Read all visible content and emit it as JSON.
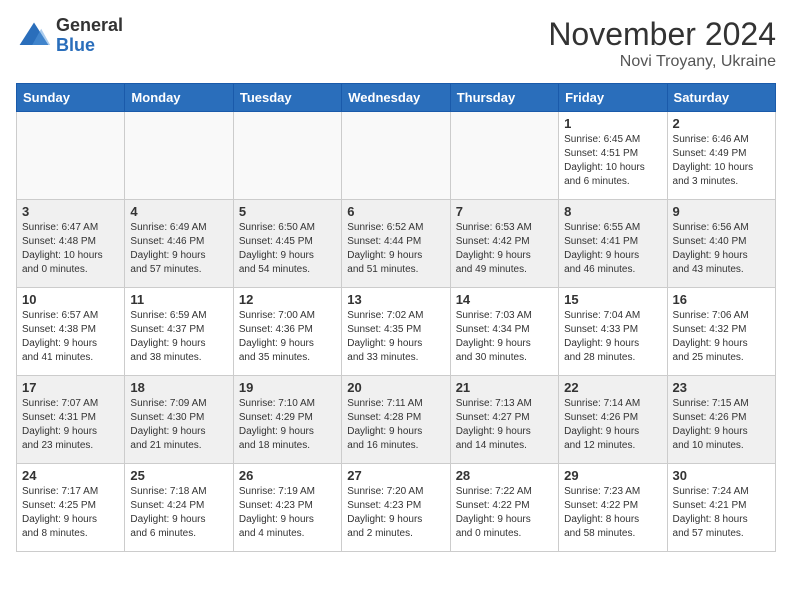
{
  "header": {
    "logo_general": "General",
    "logo_blue": "Blue",
    "month_title": "November 2024",
    "location": "Novi Troyany, Ukraine"
  },
  "weekdays": [
    "Sunday",
    "Monday",
    "Tuesday",
    "Wednesday",
    "Thursday",
    "Friday",
    "Saturday"
  ],
  "weeks": [
    [
      {
        "day": "",
        "info": "",
        "empty": true
      },
      {
        "day": "",
        "info": "",
        "empty": true
      },
      {
        "day": "",
        "info": "",
        "empty": true
      },
      {
        "day": "",
        "info": "",
        "empty": true
      },
      {
        "day": "",
        "info": "",
        "empty": true
      },
      {
        "day": "1",
        "info": "Sunrise: 6:45 AM\nSunset: 4:51 PM\nDaylight: 10 hours\nand 6 minutes."
      },
      {
        "day": "2",
        "info": "Sunrise: 6:46 AM\nSunset: 4:49 PM\nDaylight: 10 hours\nand 3 minutes."
      }
    ],
    [
      {
        "day": "3",
        "info": "Sunrise: 6:47 AM\nSunset: 4:48 PM\nDaylight: 10 hours\nand 0 minutes."
      },
      {
        "day": "4",
        "info": "Sunrise: 6:49 AM\nSunset: 4:46 PM\nDaylight: 9 hours\nand 57 minutes."
      },
      {
        "day": "5",
        "info": "Sunrise: 6:50 AM\nSunset: 4:45 PM\nDaylight: 9 hours\nand 54 minutes."
      },
      {
        "day": "6",
        "info": "Sunrise: 6:52 AM\nSunset: 4:44 PM\nDaylight: 9 hours\nand 51 minutes."
      },
      {
        "day": "7",
        "info": "Sunrise: 6:53 AM\nSunset: 4:42 PM\nDaylight: 9 hours\nand 49 minutes."
      },
      {
        "day": "8",
        "info": "Sunrise: 6:55 AM\nSunset: 4:41 PM\nDaylight: 9 hours\nand 46 minutes."
      },
      {
        "day": "9",
        "info": "Sunrise: 6:56 AM\nSunset: 4:40 PM\nDaylight: 9 hours\nand 43 minutes."
      }
    ],
    [
      {
        "day": "10",
        "info": "Sunrise: 6:57 AM\nSunset: 4:38 PM\nDaylight: 9 hours\nand 41 minutes."
      },
      {
        "day": "11",
        "info": "Sunrise: 6:59 AM\nSunset: 4:37 PM\nDaylight: 9 hours\nand 38 minutes."
      },
      {
        "day": "12",
        "info": "Sunrise: 7:00 AM\nSunset: 4:36 PM\nDaylight: 9 hours\nand 35 minutes."
      },
      {
        "day": "13",
        "info": "Sunrise: 7:02 AM\nSunset: 4:35 PM\nDaylight: 9 hours\nand 33 minutes."
      },
      {
        "day": "14",
        "info": "Sunrise: 7:03 AM\nSunset: 4:34 PM\nDaylight: 9 hours\nand 30 minutes."
      },
      {
        "day": "15",
        "info": "Sunrise: 7:04 AM\nSunset: 4:33 PM\nDaylight: 9 hours\nand 28 minutes."
      },
      {
        "day": "16",
        "info": "Sunrise: 7:06 AM\nSunset: 4:32 PM\nDaylight: 9 hours\nand 25 minutes."
      }
    ],
    [
      {
        "day": "17",
        "info": "Sunrise: 7:07 AM\nSunset: 4:31 PM\nDaylight: 9 hours\nand 23 minutes."
      },
      {
        "day": "18",
        "info": "Sunrise: 7:09 AM\nSunset: 4:30 PM\nDaylight: 9 hours\nand 21 minutes."
      },
      {
        "day": "19",
        "info": "Sunrise: 7:10 AM\nSunset: 4:29 PM\nDaylight: 9 hours\nand 18 minutes."
      },
      {
        "day": "20",
        "info": "Sunrise: 7:11 AM\nSunset: 4:28 PM\nDaylight: 9 hours\nand 16 minutes."
      },
      {
        "day": "21",
        "info": "Sunrise: 7:13 AM\nSunset: 4:27 PM\nDaylight: 9 hours\nand 14 minutes."
      },
      {
        "day": "22",
        "info": "Sunrise: 7:14 AM\nSunset: 4:26 PM\nDaylight: 9 hours\nand 12 minutes."
      },
      {
        "day": "23",
        "info": "Sunrise: 7:15 AM\nSunset: 4:26 PM\nDaylight: 9 hours\nand 10 minutes."
      }
    ],
    [
      {
        "day": "24",
        "info": "Sunrise: 7:17 AM\nSunset: 4:25 PM\nDaylight: 9 hours\nand 8 minutes."
      },
      {
        "day": "25",
        "info": "Sunrise: 7:18 AM\nSunset: 4:24 PM\nDaylight: 9 hours\nand 6 minutes."
      },
      {
        "day": "26",
        "info": "Sunrise: 7:19 AM\nSunset: 4:23 PM\nDaylight: 9 hours\nand 4 minutes."
      },
      {
        "day": "27",
        "info": "Sunrise: 7:20 AM\nSunset: 4:23 PM\nDaylight: 9 hours\nand 2 minutes."
      },
      {
        "day": "28",
        "info": "Sunrise: 7:22 AM\nSunset: 4:22 PM\nDaylight: 9 hours\nand 0 minutes."
      },
      {
        "day": "29",
        "info": "Sunrise: 7:23 AM\nSunset: 4:22 PM\nDaylight: 8 hours\nand 58 minutes."
      },
      {
        "day": "30",
        "info": "Sunrise: 7:24 AM\nSunset: 4:21 PM\nDaylight: 8 hours\nand 57 minutes."
      }
    ]
  ]
}
